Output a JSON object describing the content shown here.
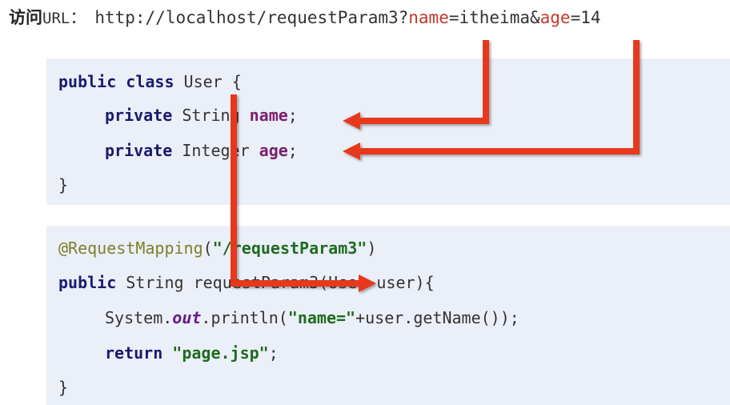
{
  "header": {
    "label_cn": "访问",
    "label_url": "URL",
    "colon": "：",
    "url_prefix": "http://localhost/requestParam3?",
    "param1_name": "name",
    "param1_eq": "=itheima&",
    "param2_name": "age",
    "param2_eq": "=14"
  },
  "class_block": {
    "line1": {
      "kw": "public class",
      "rest": " User {"
    },
    "line2": {
      "kw": "private",
      "type": " String ",
      "var": "name",
      "end": ";"
    },
    "line3": {
      "kw": "private",
      "type": " Integer ",
      "var": "age",
      "end": ";"
    },
    "line4": "}"
  },
  "method_block": {
    "line1": {
      "anno": "@RequestMapping",
      "open": "(",
      "str": "\"/requestParam3\"",
      "close": ")"
    },
    "line2": {
      "kw": "public",
      "rest": " String requestParam3(User user){"
    },
    "line3": {
      "pre": "System.",
      "ital": "out",
      "mid": ".println(",
      "str": "\"name=\"",
      "post": "+user.getName());"
    },
    "line4": {
      "kw": "return",
      "sp": " ",
      "str": "\"page.jsp\"",
      "end": ";"
    },
    "line5": "}"
  },
  "colors": {
    "arrow": "#e8381f",
    "code_bg": "#eaeff8",
    "highlight": "#c0392b"
  }
}
